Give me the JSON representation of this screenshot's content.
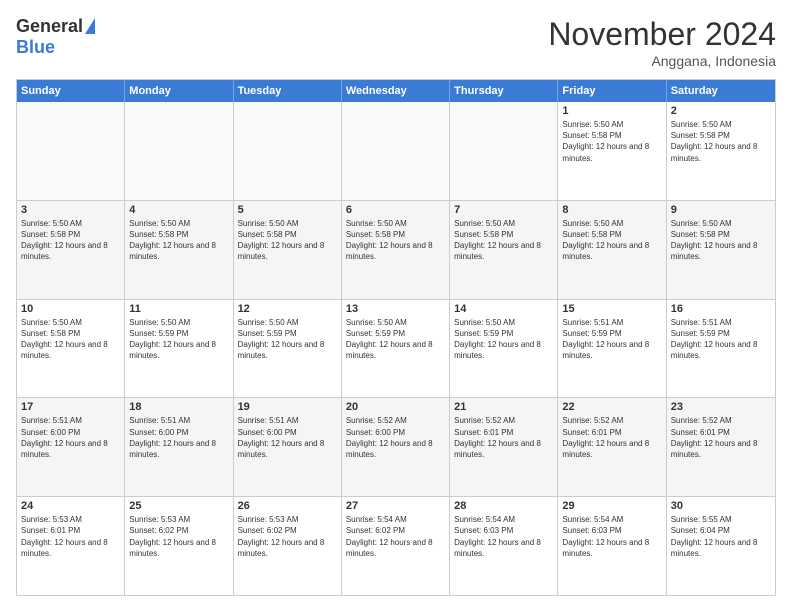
{
  "logo": {
    "general": "General",
    "blue": "Blue"
  },
  "header": {
    "month": "November 2024",
    "location": "Anggana, Indonesia"
  },
  "days_of_week": [
    "Sunday",
    "Monday",
    "Tuesday",
    "Wednesday",
    "Thursday",
    "Friday",
    "Saturday"
  ],
  "weeks": [
    [
      {
        "day": "",
        "empty": true
      },
      {
        "day": "",
        "empty": true
      },
      {
        "day": "",
        "empty": true
      },
      {
        "day": "",
        "empty": true
      },
      {
        "day": "",
        "empty": true
      },
      {
        "day": "1",
        "sunrise": "Sunrise: 5:50 AM",
        "sunset": "Sunset: 5:58 PM",
        "daylight": "Daylight: 12 hours and 8 minutes."
      },
      {
        "day": "2",
        "sunrise": "Sunrise: 5:50 AM",
        "sunset": "Sunset: 5:58 PM",
        "daylight": "Daylight: 12 hours and 8 minutes."
      }
    ],
    [
      {
        "day": "3",
        "sunrise": "Sunrise: 5:50 AM",
        "sunset": "Sunset: 5:58 PM",
        "daylight": "Daylight: 12 hours and 8 minutes."
      },
      {
        "day": "4",
        "sunrise": "Sunrise: 5:50 AM",
        "sunset": "Sunset: 5:58 PM",
        "daylight": "Daylight: 12 hours and 8 minutes."
      },
      {
        "day": "5",
        "sunrise": "Sunrise: 5:50 AM",
        "sunset": "Sunset: 5:58 PM",
        "daylight": "Daylight: 12 hours and 8 minutes."
      },
      {
        "day": "6",
        "sunrise": "Sunrise: 5:50 AM",
        "sunset": "Sunset: 5:58 PM",
        "daylight": "Daylight: 12 hours and 8 minutes."
      },
      {
        "day": "7",
        "sunrise": "Sunrise: 5:50 AM",
        "sunset": "Sunset: 5:58 PM",
        "daylight": "Daylight: 12 hours and 8 minutes."
      },
      {
        "day": "8",
        "sunrise": "Sunrise: 5:50 AM",
        "sunset": "Sunset: 5:58 PM",
        "daylight": "Daylight: 12 hours and 8 minutes."
      },
      {
        "day": "9",
        "sunrise": "Sunrise: 5:50 AM",
        "sunset": "Sunset: 5:58 PM",
        "daylight": "Daylight: 12 hours and 8 minutes."
      }
    ],
    [
      {
        "day": "10",
        "sunrise": "Sunrise: 5:50 AM",
        "sunset": "Sunset: 5:58 PM",
        "daylight": "Daylight: 12 hours and 8 minutes."
      },
      {
        "day": "11",
        "sunrise": "Sunrise: 5:50 AM",
        "sunset": "Sunset: 5:59 PM",
        "daylight": "Daylight: 12 hours and 8 minutes."
      },
      {
        "day": "12",
        "sunrise": "Sunrise: 5:50 AM",
        "sunset": "Sunset: 5:59 PM",
        "daylight": "Daylight: 12 hours and 8 minutes."
      },
      {
        "day": "13",
        "sunrise": "Sunrise: 5:50 AM",
        "sunset": "Sunset: 5:59 PM",
        "daylight": "Daylight: 12 hours and 8 minutes."
      },
      {
        "day": "14",
        "sunrise": "Sunrise: 5:50 AM",
        "sunset": "Sunset: 5:59 PM",
        "daylight": "Daylight: 12 hours and 8 minutes."
      },
      {
        "day": "15",
        "sunrise": "Sunrise: 5:51 AM",
        "sunset": "Sunset: 5:59 PM",
        "daylight": "Daylight: 12 hours and 8 minutes."
      },
      {
        "day": "16",
        "sunrise": "Sunrise: 5:51 AM",
        "sunset": "Sunset: 5:59 PM",
        "daylight": "Daylight: 12 hours and 8 minutes."
      }
    ],
    [
      {
        "day": "17",
        "sunrise": "Sunrise: 5:51 AM",
        "sunset": "Sunset: 6:00 PM",
        "daylight": "Daylight: 12 hours and 8 minutes."
      },
      {
        "day": "18",
        "sunrise": "Sunrise: 5:51 AM",
        "sunset": "Sunset: 6:00 PM",
        "daylight": "Daylight: 12 hours and 8 minutes."
      },
      {
        "day": "19",
        "sunrise": "Sunrise: 5:51 AM",
        "sunset": "Sunset: 6:00 PM",
        "daylight": "Daylight: 12 hours and 8 minutes."
      },
      {
        "day": "20",
        "sunrise": "Sunrise: 5:52 AM",
        "sunset": "Sunset: 6:00 PM",
        "daylight": "Daylight: 12 hours and 8 minutes."
      },
      {
        "day": "21",
        "sunrise": "Sunrise: 5:52 AM",
        "sunset": "Sunset: 6:01 PM",
        "daylight": "Daylight: 12 hours and 8 minutes."
      },
      {
        "day": "22",
        "sunrise": "Sunrise: 5:52 AM",
        "sunset": "Sunset: 6:01 PM",
        "daylight": "Daylight: 12 hours and 8 minutes."
      },
      {
        "day": "23",
        "sunrise": "Sunrise: 5:52 AM",
        "sunset": "Sunset: 6:01 PM",
        "daylight": "Daylight: 12 hours and 8 minutes."
      }
    ],
    [
      {
        "day": "24",
        "sunrise": "Sunrise: 5:53 AM",
        "sunset": "Sunset: 6:01 PM",
        "daylight": "Daylight: 12 hours and 8 minutes."
      },
      {
        "day": "25",
        "sunrise": "Sunrise: 5:53 AM",
        "sunset": "Sunset: 6:02 PM",
        "daylight": "Daylight: 12 hours and 8 minutes."
      },
      {
        "day": "26",
        "sunrise": "Sunrise: 5:53 AM",
        "sunset": "Sunset: 6:02 PM",
        "daylight": "Daylight: 12 hours and 8 minutes."
      },
      {
        "day": "27",
        "sunrise": "Sunrise: 5:54 AM",
        "sunset": "Sunset: 6:02 PM",
        "daylight": "Daylight: 12 hours and 8 minutes."
      },
      {
        "day": "28",
        "sunrise": "Sunrise: 5:54 AM",
        "sunset": "Sunset: 6:03 PM",
        "daylight": "Daylight: 12 hours and 8 minutes."
      },
      {
        "day": "29",
        "sunrise": "Sunrise: 5:54 AM",
        "sunset": "Sunset: 6:03 PM",
        "daylight": "Daylight: 12 hours and 8 minutes."
      },
      {
        "day": "30",
        "sunrise": "Sunrise: 5:55 AM",
        "sunset": "Sunset: 6:04 PM",
        "daylight": "Daylight: 12 hours and 8 minutes."
      }
    ]
  ]
}
